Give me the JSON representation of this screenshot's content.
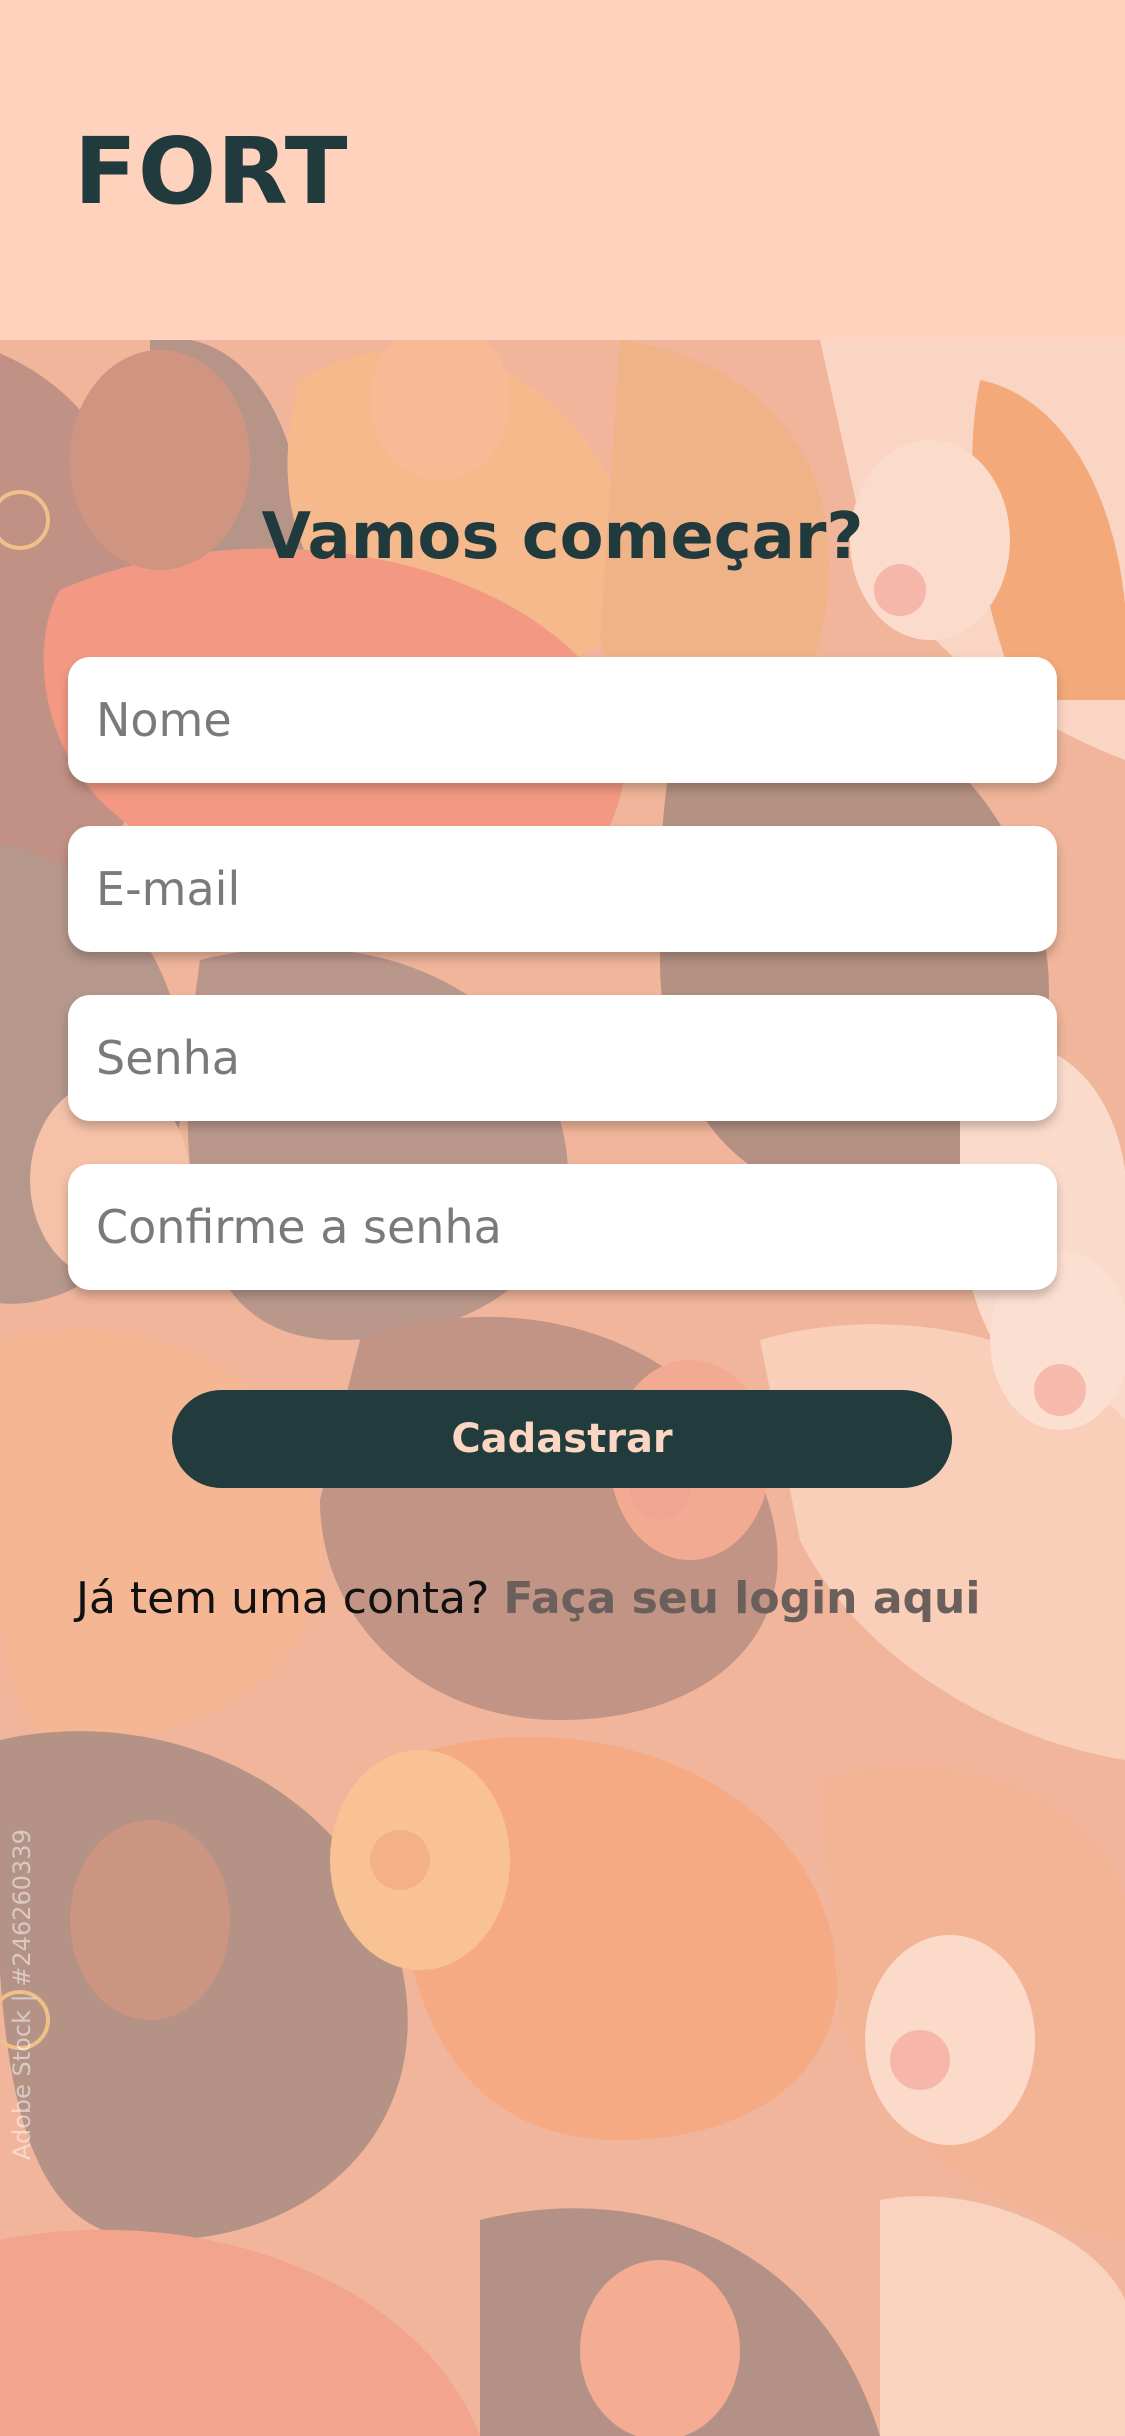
{
  "app": {
    "brand": "FORT"
  },
  "form": {
    "title": "Vamos começar?",
    "fields": [
      {
        "placeholder": "Nome",
        "value": ""
      },
      {
        "placeholder": "E-mail",
        "value": ""
      },
      {
        "placeholder": "Senha",
        "value": ""
      },
      {
        "placeholder": "Confirme a senha",
        "value": ""
      }
    ],
    "submit_label": "Cadastrar"
  },
  "footer": {
    "prompt": "Já tem uma conta?",
    "link_label": "Faça seu login aqui"
  },
  "background": {
    "watermark": "Adobe Stock | #246260339"
  },
  "colors": {
    "header_bg": "#FFD2BE",
    "brand_text": "#213A3D",
    "button_bg": "#223B3D",
    "button_text": "#FBD6C3",
    "link_text": "#6B5F5B"
  }
}
